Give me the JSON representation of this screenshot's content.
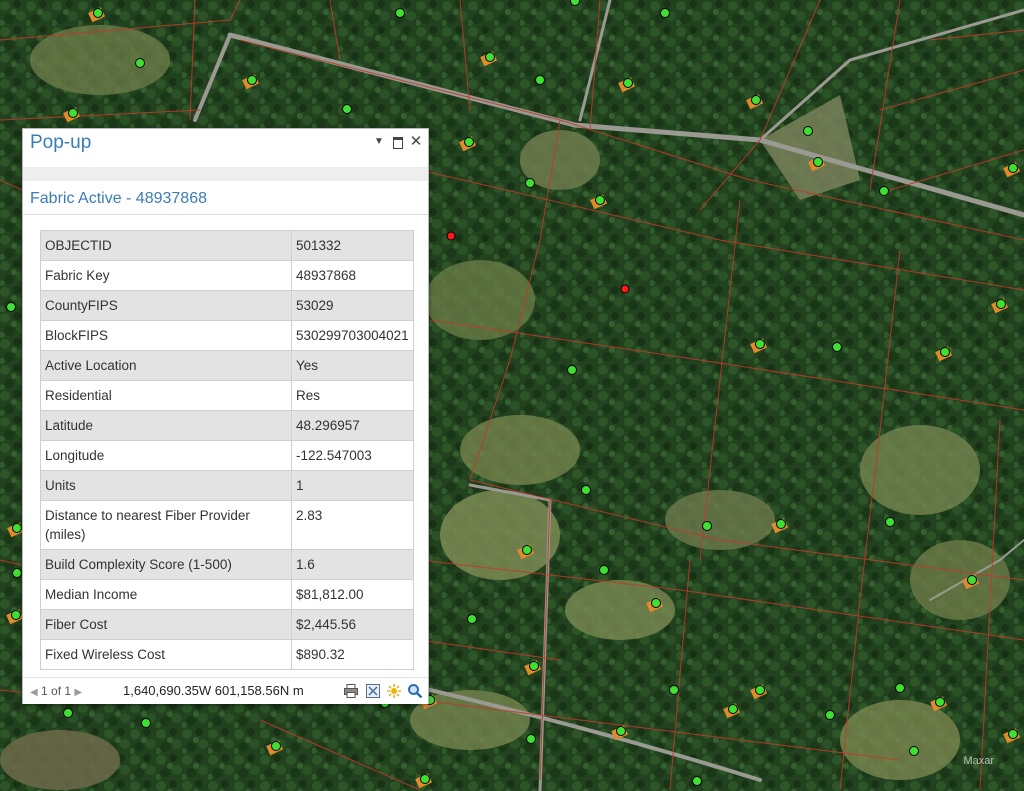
{
  "popup": {
    "title": "Pop-up",
    "feature_title": "Fabric Active - 48937868",
    "attributes": [
      {
        "field": "OBJECTID",
        "value": "501332"
      },
      {
        "field": "Fabric Key",
        "value": "48937868"
      },
      {
        "field": "CountyFIPS",
        "value": "53029"
      },
      {
        "field": "BlockFIPS",
        "value": "530299703004021"
      },
      {
        "field": "Active Location",
        "value": "Yes"
      },
      {
        "field": "Residential",
        "value": "Res"
      },
      {
        "field": "Latitude",
        "value": "48.296957"
      },
      {
        "field": "Longitude",
        "value": "-122.547003"
      },
      {
        "field": "Units",
        "value": "1"
      },
      {
        "field": "Distance to nearest Fiber Provider (miles)",
        "value": "2.83"
      },
      {
        "field": "Build Complexity Score (1-500)",
        "value": "1.6"
      },
      {
        "field": "Median Income",
        "value": "$81,812.00"
      },
      {
        "field": "Fiber Cost",
        "value": "$2,445.56"
      },
      {
        "field": "Fixed Wireless Cost",
        "value": "$890.32"
      }
    ],
    "footer": {
      "pager": "1 of 1",
      "coordinates": "1,640,690.35W 601,158.56N m"
    },
    "icons": {
      "dropdown": "chevron-down-icon",
      "maximize": "maximize-icon",
      "close": "close-icon",
      "print": "print-icon",
      "export": "export-icon",
      "flash": "flash-icon",
      "zoom": "zoom-to-icon"
    }
  },
  "map": {
    "attribution": "Maxar",
    "colors": {
      "parcel_lines": "#c0392b",
      "active_location": "#3ee032",
      "inactive_location": "#ff1a1a",
      "building": "#e08a2a",
      "forest": "#21431f",
      "clearing": "#6d7a4e"
    }
  }
}
